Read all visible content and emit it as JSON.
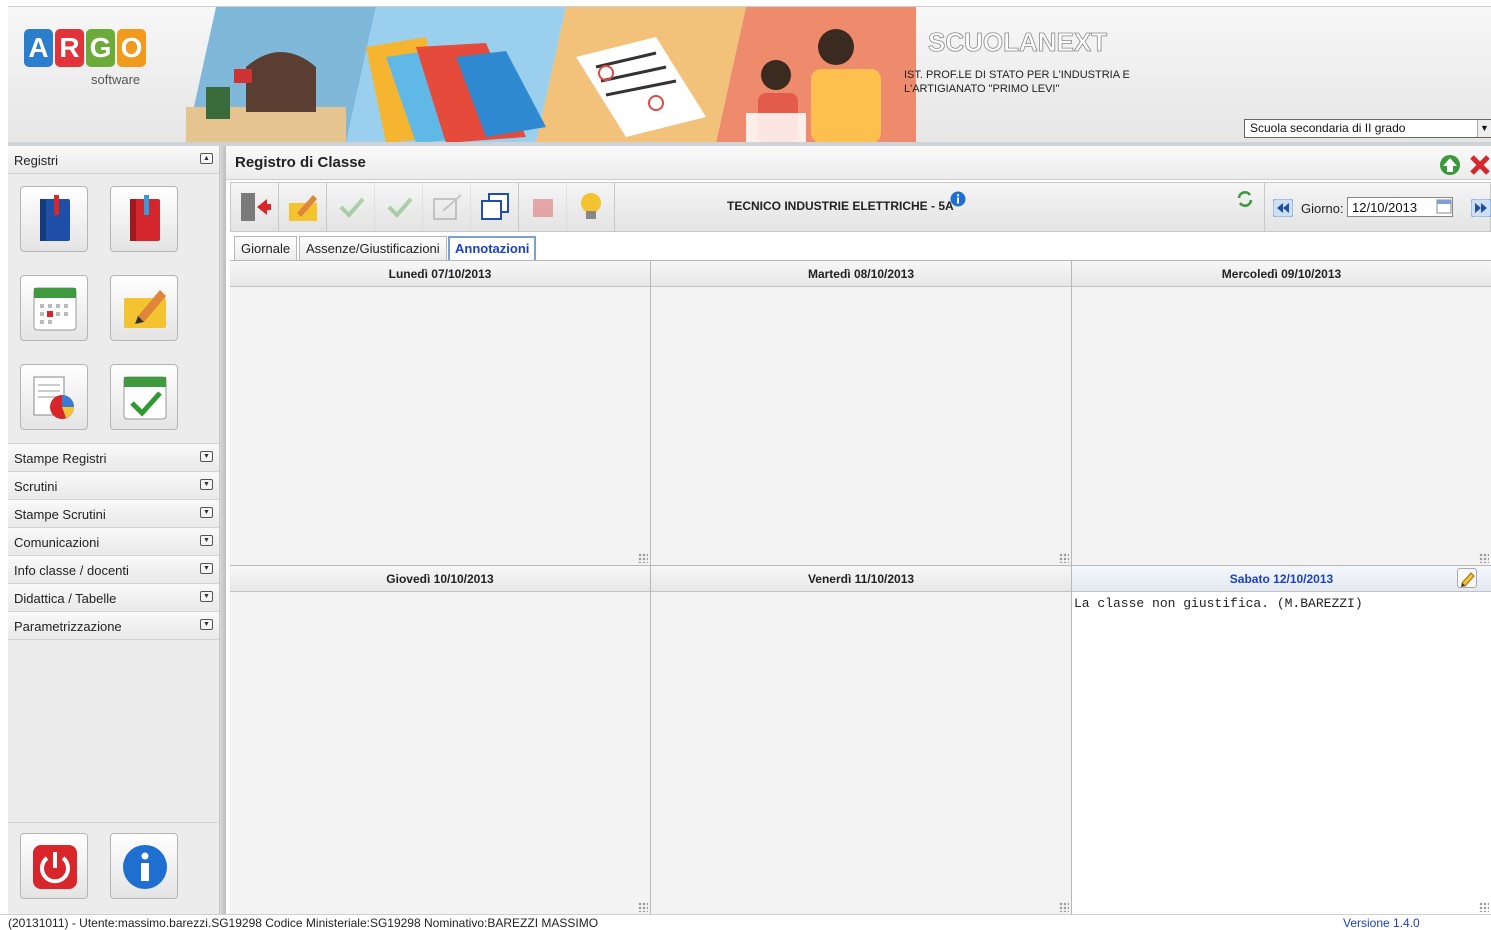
{
  "header": {
    "brand_software": "software",
    "product_name": "SCUOLANEXT",
    "school_name": "IST. PROF.LE DI STATO PER L'INDUSTRIA E L'ARTIGIANATO \"PRIMO LEVI\"",
    "school_extra": "",
    "school_select": "Scuola secondaria di II grado",
    "colors": {
      "argo_a": "#2a7ecb",
      "argo_r": "#e0343a",
      "argo_g": "#6cab3a",
      "argo_o": "#f09a1e"
    }
  },
  "sidebar": {
    "registri_label": "Registri",
    "registri_buttons": [
      {
        "icon": "register-blue-book-icon"
      },
      {
        "icon": "register-red-book-icon"
      },
      {
        "icon": "calendar-icon"
      },
      {
        "icon": "notepad-pencil-icon"
      },
      {
        "icon": "report-chart-icon"
      },
      {
        "icon": "calendar-check-icon"
      }
    ],
    "sections": [
      "Stampe Registri",
      "Scrutini",
      "Stampe Scrutini",
      "Comunicazioni",
      "Info classe / docenti",
      "Didattica / Tabelle",
      "Parametrizzazione"
    ],
    "bottom_buttons": [
      {
        "icon": "power-icon"
      },
      {
        "icon": "info-icon"
      }
    ]
  },
  "main": {
    "title": "Registro di Classe",
    "class_label": "TECNICO INDUSTRIE ELETTRICHE - 5A",
    "giorno_label": "Giorno:",
    "giorno_value": "12/10/2013",
    "tabs": [
      "Giornale",
      "Assenze/Giustificazioni",
      "Annotazioni"
    ],
    "active_tab": "Annotazioni",
    "days": [
      {
        "label": "Lunedì 07/10/2013",
        "note": ""
      },
      {
        "label": "Martedì 08/10/2013",
        "note": ""
      },
      {
        "label": "Mercoledì 09/10/2013",
        "note": ""
      },
      {
        "label": "Giovedì 10/10/2013",
        "note": ""
      },
      {
        "label": "Venerdì 11/10/2013",
        "note": ""
      },
      {
        "label": "Sabato 12/10/2013",
        "note": "La classe non giustifica. (M.BAREZZI)"
      }
    ]
  },
  "status": {
    "text": "(20131011) - Utente:massimo.barezzi.SG19298 Codice Ministeriale:SG19298 Nominativo:BAREZZI MASSIMO",
    "version": "Versione 1.4.0"
  }
}
